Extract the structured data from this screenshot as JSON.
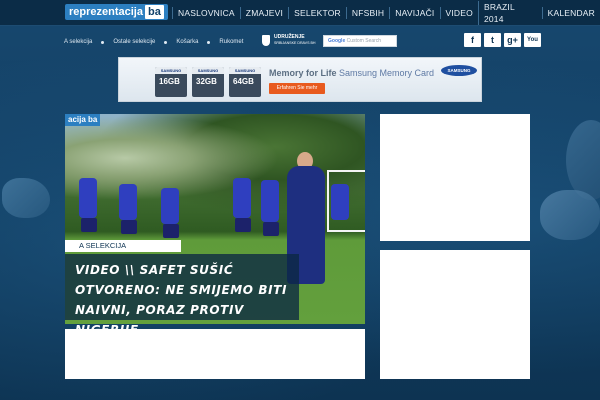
{
  "site": {
    "logo_main": "reprezentacija",
    "logo_suffix": "ba",
    "feature_logo": "acija ba"
  },
  "main_nav": {
    "items": [
      {
        "label": "NASLOVNICA"
      },
      {
        "label": "ZMAJEVI"
      },
      {
        "label": "SELEKTOR"
      },
      {
        "label": "NFSBIH"
      },
      {
        "label": "NAVIJAČI"
      },
      {
        "label": "VIDEO"
      },
      {
        "label": "BRAZIL 2014"
      },
      {
        "label": "KALENDAR"
      }
    ]
  },
  "sub_nav": {
    "items": [
      {
        "label": "A selekcija"
      },
      {
        "label": "Ostale selekcije"
      },
      {
        "label": "Košarka"
      },
      {
        "label": "Rukomet"
      }
    ]
  },
  "udruzenje": {
    "title": "UDRUŽENJE",
    "subtitle": "SRBIJANSKE DRAVS BH"
  },
  "search": {
    "brand": "Google",
    "placeholder": "Custom Search"
  },
  "social": {
    "items": [
      {
        "icon": "facebook-icon",
        "glyph": "f"
      },
      {
        "icon": "twitter-icon",
        "glyph": "t"
      },
      {
        "icon": "google-plus-icon",
        "glyph": "g+"
      },
      {
        "icon": "youtube-icon",
        "glyph": "You"
      }
    ]
  },
  "banner": {
    "cards": [
      {
        "brand": "SAMSUNG",
        "cap": "16GB"
      },
      {
        "brand": "SAMSUNG",
        "cap": "32GB"
      },
      {
        "brand": "SAMSUNG",
        "cap": "64GB"
      }
    ],
    "title_main": "Memory for Life",
    "title_sub": "Samsung Memory Card",
    "cta": "Erfahren Sie mehr",
    "brand_logo": "SAMSUNG"
  },
  "feature": {
    "category": "A SELEKCIJA",
    "headline": "VIDEO \\\\ SAFET SUŠIĆ OTVORENO: NE SMIJEMO BITI NAIVNI, PORAZ PROTIV NIGERIJE ..."
  },
  "colors": {
    "background": "#0e3a5e",
    "topbar": "#0b2c47",
    "accent": "#2c7fc1",
    "banner_cta": "#e85a1e"
  }
}
